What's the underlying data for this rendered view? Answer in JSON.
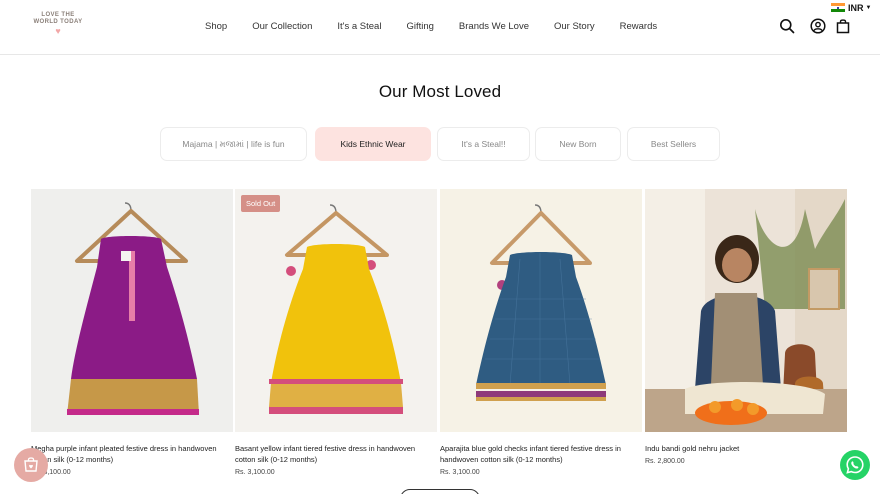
{
  "header": {
    "logo_line1": "LOVE THE",
    "logo_line2": "WORLD TODAY",
    "logo_heart": "♥",
    "nav": [
      "Shop",
      "Our Collection",
      "It's a Steal",
      "Gifting",
      "Brands We Love",
      "Our Story",
      "Rewards"
    ],
    "icons": [
      "search-icon",
      "account-icon",
      "bag-icon"
    ],
    "currency": "INR"
  },
  "section": {
    "title": "Our Most Loved",
    "tabs": [
      "Majama | મજામાં | life is fun",
      "Kids Ethnic Wear",
      "It's a Steal!!",
      "New Born",
      "Best Sellers"
    ],
    "active_tab": "Kids Ethnic Wear"
  },
  "products": [
    {
      "name": "Megha purple infant pleated festive dress in handwoven cotton silk (0-12 months)",
      "price": "Rs. 3,100.00",
      "badge": "",
      "colors": {
        "dress": "#8a1a86",
        "border": "#d7a24a",
        "bg": "#eeeeec"
      }
    },
    {
      "name": "Basant yellow infant tiered festive dress in handwoven cotton silk (0-12 months)",
      "price": "Rs. 3,100.00",
      "badge": "Sold Out",
      "colors": {
        "dress": "#f2c30c",
        "border": "#d24f7a",
        "bg": "#f3f1ec"
      }
    },
    {
      "name": "Aparajita blue gold checks infant tiered festive dress in handwoven cotton silk (0-12 months)",
      "price": "Rs. 3,100.00",
      "badge": "",
      "colors": {
        "dress": "#2d5a80",
        "border": "#8e3a7a",
        "bg": "#f5f1e6"
      }
    },
    {
      "name": "Indu bandi gold nehru jacket",
      "price": "Rs. 2,800.00",
      "badge": "",
      "colors": {
        "dress": "#a08e74",
        "border": "#f07a1a",
        "bg": "#efe6dc"
      }
    }
  ],
  "accent": "#fde3e0",
  "floating": {
    "cart_icon": "cart-heart-icon",
    "whatsapp_icon": "whatsapp-icon"
  }
}
